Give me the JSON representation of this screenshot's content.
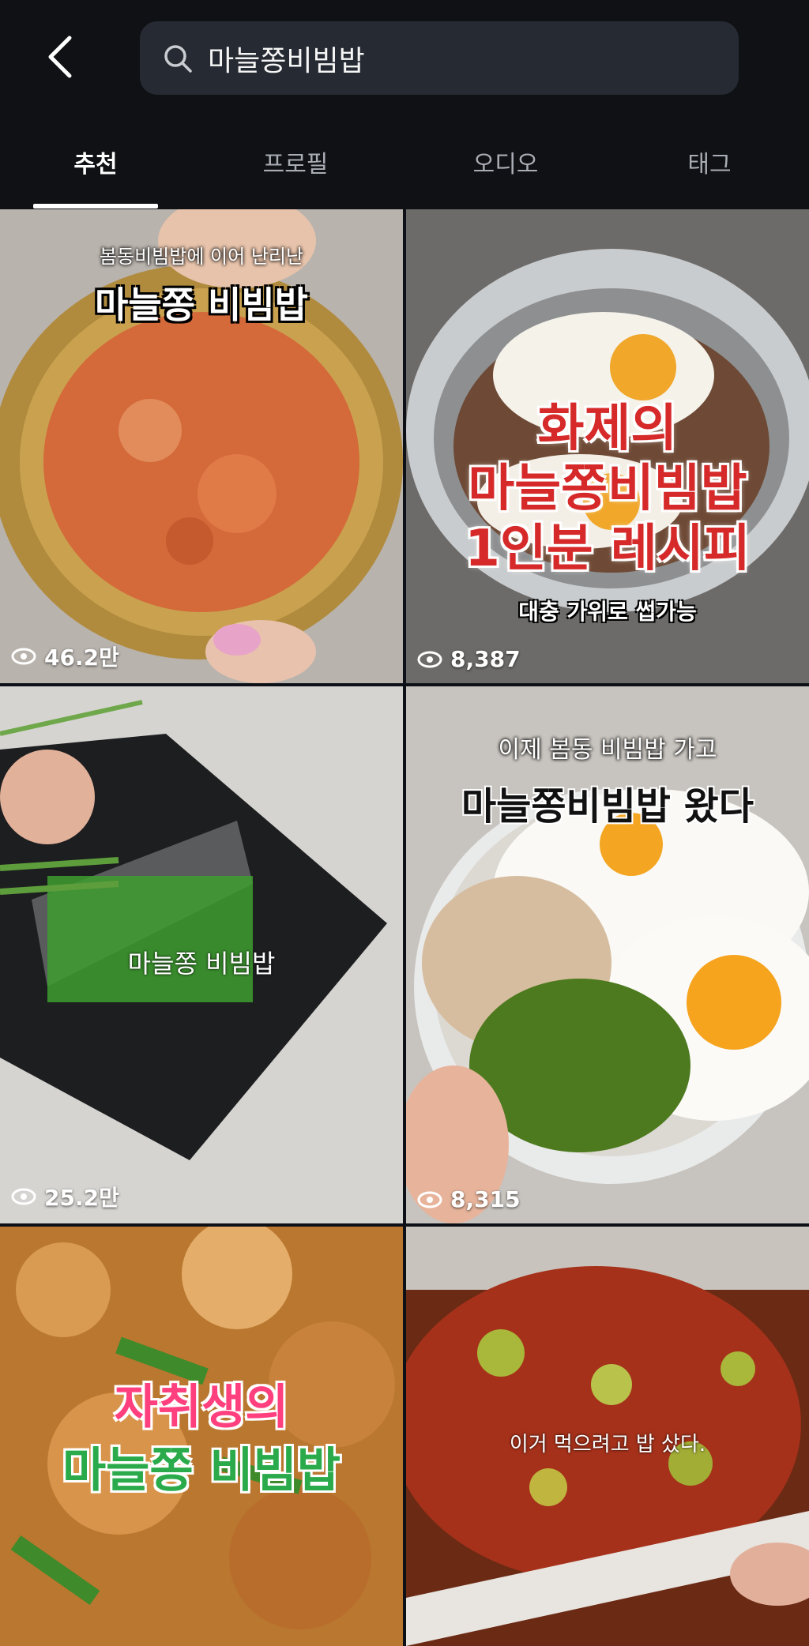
{
  "header": {
    "back_icon": "chevron-left-icon",
    "search_icon": "search-icon",
    "search_value": "마늘쫑비빔밥"
  },
  "tabs": [
    {
      "label": "추천",
      "active": true
    },
    {
      "label": "프로필",
      "active": false
    },
    {
      "label": "오디오",
      "active": false
    },
    {
      "label": "태그",
      "active": false
    }
  ],
  "results": [
    {
      "views": "46.2만",
      "caption_top": "봄동비빔밥에 이어 난리난",
      "caption_main": "마늘쫑 비빔밥"
    },
    {
      "views": "8,387",
      "caption_main_lines": [
        "화제의",
        "마늘쫑비빔밥",
        "1인분 레시피"
      ],
      "caption_bottom": "대충 가위로 썹가능"
    },
    {
      "views": "25.2만",
      "caption_main": "마늘쫑 비빔밥"
    },
    {
      "views": "8,315",
      "caption_top": "이제 봄동 비빔밥 가고",
      "caption_main": "마늘쫑비빔밥 왔다"
    },
    {
      "caption_lines": [
        "자취생의",
        "마늘쫑 비빔밥"
      ]
    },
    {
      "caption_main": "이거 먹으려고 밥 샀다."
    }
  ],
  "colors": {
    "background": "#0f1115",
    "search_field": "#262a32",
    "active_tab": "#ffffff",
    "inactive_tab": "#a9adb4"
  }
}
